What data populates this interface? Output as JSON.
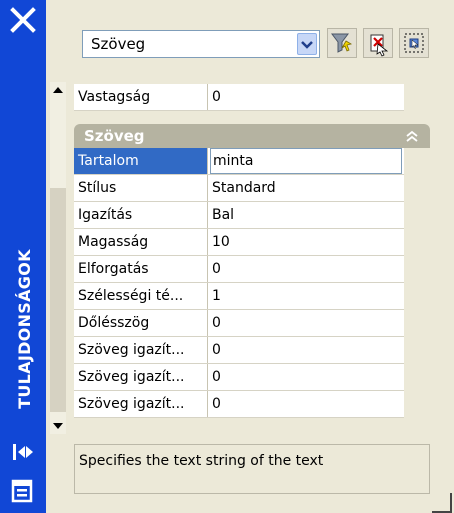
{
  "palette_title": "TULAJDONSÁGOK",
  "object_type_select": {
    "value": "Szöveg"
  },
  "general_rows": [
    {
      "name": "Vastagság",
      "value": "0"
    }
  ],
  "category": {
    "label": "Szöveg"
  },
  "text_rows": [
    {
      "name": "Tartalom",
      "value": "minta"
    },
    {
      "name": "Stílus",
      "value": "Standard"
    },
    {
      "name": "Igazítás",
      "value": "Bal"
    },
    {
      "name": "Magasság",
      "value": "10"
    },
    {
      "name": "Elforgatás",
      "value": "0"
    },
    {
      "name": "Szélességi té...",
      "value": "1"
    },
    {
      "name": "Dőlésszög",
      "value": "0"
    },
    {
      "name": "Szöveg igazít...",
      "value": "0"
    },
    {
      "name": "Szöveg igazít...",
      "value": "0"
    },
    {
      "name": "Szöveg igazít...",
      "value": "0"
    }
  ],
  "description": "Specifies the text string of the text",
  "colors": {
    "title_bar": "#1147d6",
    "panel": "#ece9d8",
    "selected": "#316ac5",
    "category": "#b5b3a1"
  },
  "icons": [
    "close-icon",
    "chevron-down-icon",
    "quick-select-icon",
    "toggle-pickadd-icon",
    "select-objects-icon",
    "scroll-up-arrow",
    "scroll-down-arrow",
    "collapse-icon",
    "autohide-icon",
    "properties-menu-icon"
  ]
}
